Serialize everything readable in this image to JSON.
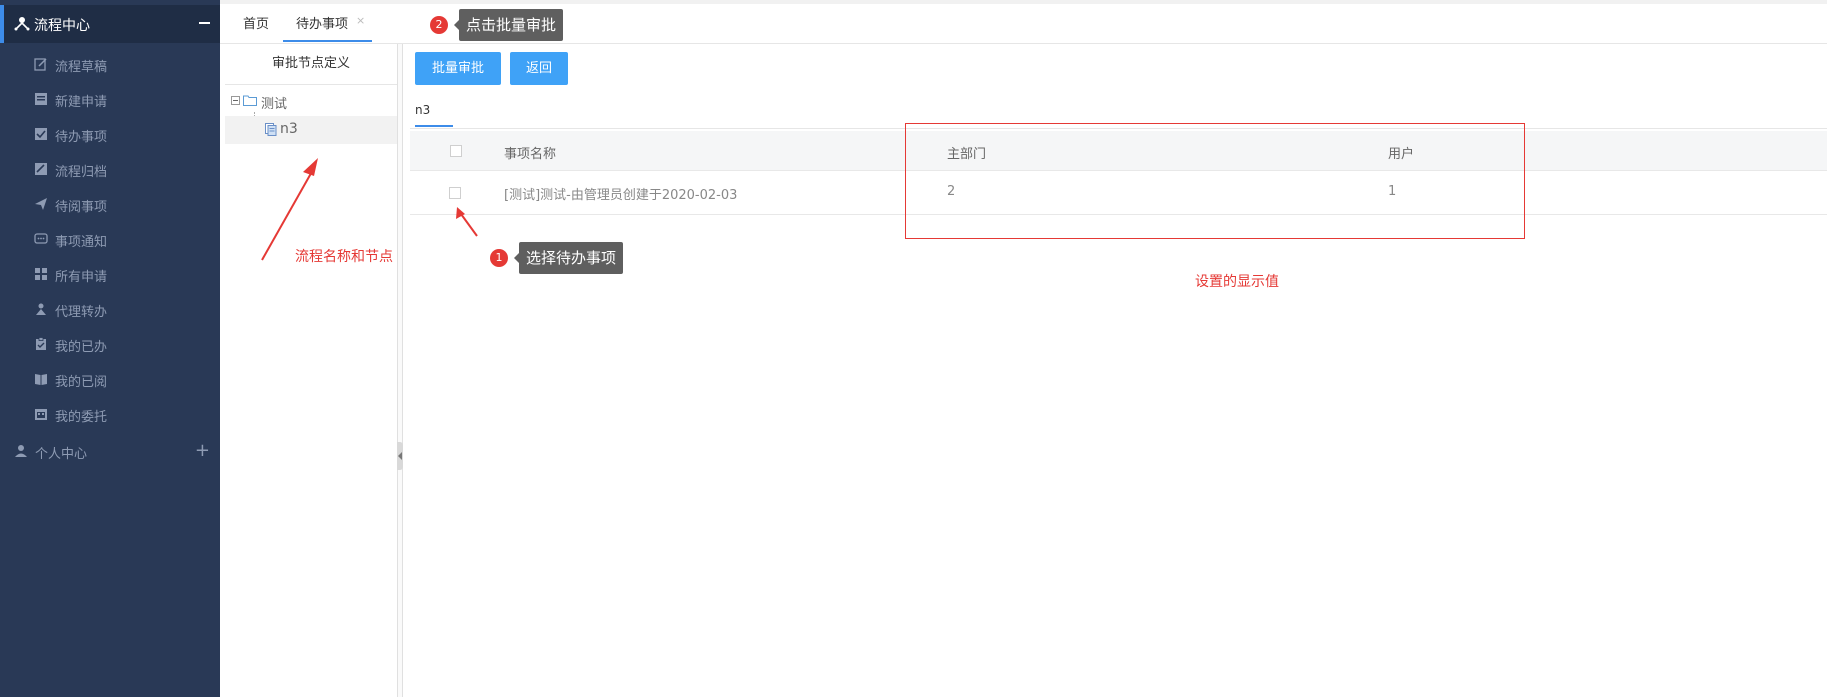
{
  "sidebar": {
    "header": "流程中心",
    "items": [
      {
        "label": "流程草稿",
        "icon": "edit-icon"
      },
      {
        "label": "新建申请",
        "icon": "form-icon"
      },
      {
        "label": "待办事项",
        "icon": "todo-icon"
      },
      {
        "label": "流程归档",
        "icon": "archive-icon"
      },
      {
        "label": "待阅事项",
        "icon": "send-icon"
      },
      {
        "label": "事项通知",
        "icon": "chat-icon"
      },
      {
        "label": "所有申请",
        "icon": "grid-icon"
      },
      {
        "label": "代理转办",
        "icon": "delegate-icon"
      },
      {
        "label": "我的已办",
        "icon": "clipboard-icon"
      },
      {
        "label": "我的已阅",
        "icon": "book-icon"
      },
      {
        "label": "我的委托",
        "icon": "calendar-icon"
      }
    ],
    "personal": "个人中心"
  },
  "tabs": {
    "home": "首页",
    "todo": "待办事项",
    "close": "×"
  },
  "tree": {
    "title": "审批节点定义",
    "root": "测试",
    "child": "n3"
  },
  "toolbar": {
    "batch_approve": "批量审批",
    "back": "返回"
  },
  "subtab": "n3",
  "table": {
    "headers": [
      "事项名称",
      "主部门",
      "用户"
    ],
    "rows": [
      {
        "name": "[测试]测试-由管理员创建于2020-02-03",
        "dept": "2",
        "user": "1"
      }
    ]
  },
  "annotations": {
    "step1_num": "1",
    "step1_text": "选择待办事项",
    "step2_num": "2",
    "step2_text": "点击批量审批",
    "process_note": "流程名称和节点",
    "display_note": "设置的显示值"
  },
  "colors": {
    "sidebar_bg": "#293956",
    "accent": "#3d8ce9",
    "button": "#3fa2f7",
    "annotation_red": "#e53935"
  }
}
